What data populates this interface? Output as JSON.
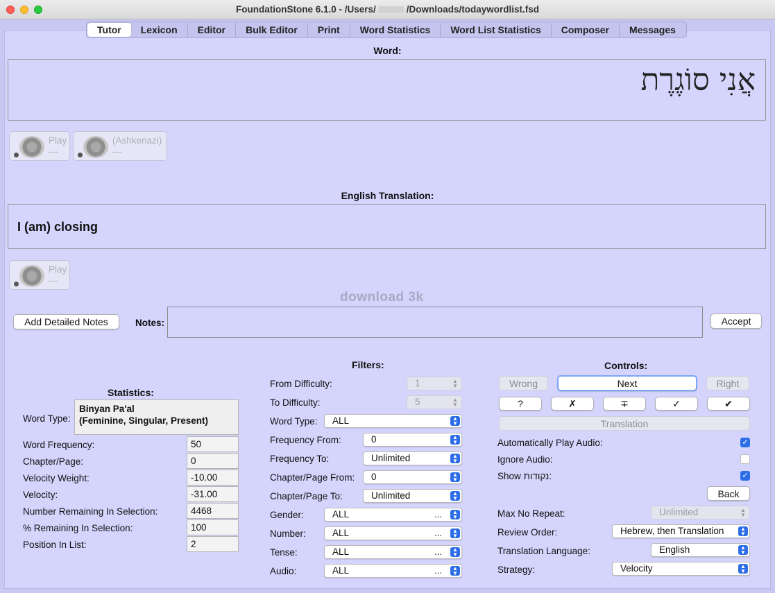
{
  "window": {
    "title": "FoundationStone 6.1.0 - /Users/",
    "title_path": "/Downloads/todaywordlist.fsd"
  },
  "tabs": [
    "Tutor",
    "Lexicon",
    "Editor",
    "Bulk Editor",
    "Print",
    "Word Statistics",
    "Word List Statistics",
    "Composer",
    "Messages"
  ],
  "word_section": {
    "header": "Word:",
    "hebrew_word": "אֲנִי סוֹגֶרֶת",
    "audio_buttons": [
      {
        "label": "Play",
        "sub": "---"
      },
      {
        "label": "(Ashkenazi)",
        "sub": "---"
      }
    ]
  },
  "translation_section": {
    "header": "English Translation:",
    "text": "I (am) closing",
    "audio_button": {
      "label": "Play",
      "sub": "---"
    }
  },
  "watermark": "download 3k",
  "notes": {
    "add_button": "Add Detailed Notes",
    "label": "Notes:",
    "value": "",
    "accept_button": "Accept"
  },
  "statistics": {
    "header": "Statistics:",
    "word_type_label": "Word Type:",
    "word_type_line1": "Binyan Pa'al",
    "word_type_line2": "(Feminine, Singular, Present)",
    "rows": [
      {
        "label": "Word Frequency:",
        "value": "50"
      },
      {
        "label": "Chapter/Page:",
        "value": "0"
      },
      {
        "label": "Velocity Weight:",
        "value": "-10.00"
      },
      {
        "label": "Velocity:",
        "value": "-31.00"
      },
      {
        "label": "Number Remaining In Selection:",
        "value": "4468"
      },
      {
        "label": "% Remaining In Selection:",
        "value": "100"
      },
      {
        "label": "Position In List:",
        "value": "2"
      }
    ]
  },
  "filters": {
    "header": "Filters:",
    "from_difficulty": {
      "label": "From Difficulty:",
      "value": "1"
    },
    "to_difficulty": {
      "label": "To Difficulty:",
      "value": "5"
    },
    "word_type": {
      "label": "Word Type:",
      "value": "ALL"
    },
    "frequency_from": {
      "label": "Frequency From:",
      "value": "0"
    },
    "frequency_to": {
      "label": "Frequency To:",
      "value": "Unlimited"
    },
    "chapter_from": {
      "label": "Chapter/Page From:",
      "value": "0"
    },
    "chapter_to": {
      "label": "Chapter/Page To:",
      "value": "Unlimited"
    },
    "gender": {
      "label": "Gender:",
      "value": "ALL"
    },
    "number": {
      "label": "Number:",
      "value": "ALL"
    },
    "tense": {
      "label": "Tense:",
      "value": "ALL"
    },
    "audio": {
      "label": "Audio:",
      "value": "ALL"
    },
    "ellipsis": "..."
  },
  "controls": {
    "header": "Controls:",
    "wrong": "Wrong",
    "next": "Next",
    "right": "Right",
    "mark_buttons": [
      "?",
      "✗",
      "∓",
      "✓",
      "✔"
    ],
    "translation": "Translation",
    "auto_play_label": "Automatically Play Audio:",
    "ignore_audio_label": "Ignore Audio:",
    "show_nikud_label": "Show נקודות:",
    "check_mark": "✓",
    "back": "Back",
    "max_no_repeat": {
      "label": "Max No Repeat:",
      "value": "Unlimited"
    },
    "review_order": {
      "label": "Review Order:",
      "value": "Hebrew, then Translation"
    },
    "translation_language": {
      "label": "Translation Language:",
      "value": "English"
    },
    "strategy": {
      "label": "Strategy:",
      "value": "Velocity"
    }
  },
  "colors": {
    "background": "#d4d4fc",
    "accent": "#2d6ee8"
  }
}
